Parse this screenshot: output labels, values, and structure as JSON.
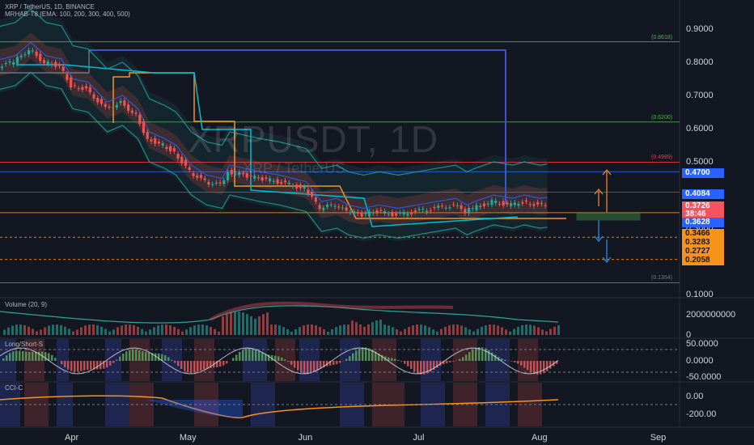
{
  "header": {
    "symbol_line": "XRP / TetherUS, 1D, BINANCE",
    "indicator_line": "MRHAB-T8 (EMA: 100, 200, 300, 400, 500)"
  },
  "watermark": {
    "ticker": "XRPUSDT, 1D",
    "name": "XRP / TetherUS"
  },
  "panes": {
    "volume": "Volume (20, 9)",
    "long_short": "Long/Short-S",
    "third": "CCI-C"
  },
  "colors": {
    "background": "#131722",
    "up": "#26a69a",
    "down": "#ef5350",
    "blue_tag": "#2962ff",
    "orange_tag": "#f7931a",
    "red_tag": "#f23645"
  },
  "price_tags": [
    {
      "label": "0.4700",
      "price": 0.47,
      "style": "blue"
    },
    {
      "label": "0.4084",
      "price": 0.4084,
      "style": "blue"
    },
    {
      "label": "0.3726",
      "price": 0.3726,
      "style": "red"
    },
    {
      "label": "38:46",
      "price": 0.3726,
      "style": "red-sub"
    },
    {
      "label": "0.3628",
      "price": 0.3628,
      "style": "blue"
    },
    {
      "label": "0.3466",
      "price": 0.3466,
      "style": "orange"
    },
    {
      "label": "0.3283",
      "price": 0.3283,
      "style": "orange"
    },
    {
      "label": "0.2727",
      "price": 0.2727,
      "style": "orange"
    },
    {
      "label": "0.2058",
      "price": 0.2058,
      "style": "orange"
    }
  ],
  "fib_labels": [
    {
      "text": "(0.8618)",
      "price": 0.8618,
      "color": "#4caf50"
    },
    {
      "text": "(0.6200)",
      "price": 0.62,
      "color": "#4caf50"
    },
    {
      "text": "(0.4989)",
      "price": 0.4989,
      "color": "#f23645"
    },
    {
      "text": "(0.1354)",
      "price": 0.1354,
      "color": "#787b86"
    }
  ],
  "chart_data": {
    "type": "candlestick",
    "price_axis": {
      "ticks": [
        "0.9000",
        "0.8000",
        "0.7000",
        "0.6000",
        "0.5000",
        "0.4000",
        "0.3000",
        "0.2000",
        "0.1000"
      ],
      "values": [
        0.9,
        0.8,
        0.7,
        0.6,
        0.5,
        0.4,
        0.3,
        0.2,
        0.1
      ]
    },
    "volume_axis": {
      "ticks": [
        "2000000000",
        "0"
      ],
      "values": [
        2000000000,
        0
      ]
    },
    "osc_axis": {
      "ticks": [
        "50.0000",
        "0.0000",
        "-50.0000"
      ],
      "values": [
        50,
        0,
        -50
      ]
    },
    "cci_axis": {
      "ticks": [
        "0.00",
        "-200.00"
      ],
      "values": [
        0,
        -200
      ]
    },
    "x_axis": {
      "ticks": [
        "Apr",
        "May",
        "Jun",
        "Jul",
        "Aug",
        "Sep"
      ],
      "dates": [
        "2023-04-01",
        "2023-05-01",
        "2023-06-01",
        "2023-07-01",
        "2023-08-01",
        "2023-09-01"
      ]
    },
    "close_series": {
      "dates": [
        "2023-03-10",
        "2023-03-17",
        "2023-03-21",
        "2023-03-25",
        "2023-03-29",
        "2023-04-01",
        "2023-04-05",
        "2023-04-10",
        "2023-04-14",
        "2023-04-18",
        "2023-04-21",
        "2023-04-25",
        "2023-04-28",
        "2023-05-02",
        "2023-05-06",
        "2023-05-10",
        "2023-05-12",
        "2023-05-16",
        "2023-05-20",
        "2023-05-25",
        "2023-06-01",
        "2023-06-05",
        "2023-06-09",
        "2023-06-12",
        "2023-06-16",
        "2023-06-20",
        "2023-06-25",
        "2023-06-30",
        "2023-07-05",
        "2023-07-10",
        "2023-07-13",
        "2023-07-15",
        "2023-07-20",
        "2023-07-25",
        "2023-07-28",
        "2023-08-01",
        "2023-08-03"
      ],
      "values": [
        0.78,
        0.8,
        0.84,
        0.8,
        0.79,
        0.73,
        0.72,
        0.66,
        0.68,
        0.64,
        0.57,
        0.55,
        0.53,
        0.47,
        0.44,
        0.43,
        0.47,
        0.46,
        0.45,
        0.44,
        0.42,
        0.36,
        0.37,
        0.35,
        0.34,
        0.35,
        0.34,
        0.35,
        0.36,
        0.37,
        0.35,
        0.36,
        0.38,
        0.37,
        0.38,
        0.37,
        0.373
      ]
    },
    "levels": [
      {
        "price": 0.8618,
        "color": "#4caf50"
      },
      {
        "price": 0.62,
        "color": "#4caf50"
      },
      {
        "price": 0.4989,
        "color": "#f23645"
      },
      {
        "price": 0.47,
        "color": "#2962ff"
      },
      {
        "price": 0.4084,
        "color": "#2962ff"
      },
      {
        "price": 0.3466,
        "color": "#f7931a"
      },
      {
        "price": 0.2727,
        "color": "#f7931a"
      },
      {
        "price": 0.2058,
        "color": "#f7931a"
      },
      {
        "price": 0.1354,
        "color": "#787b86"
      }
    ]
  }
}
